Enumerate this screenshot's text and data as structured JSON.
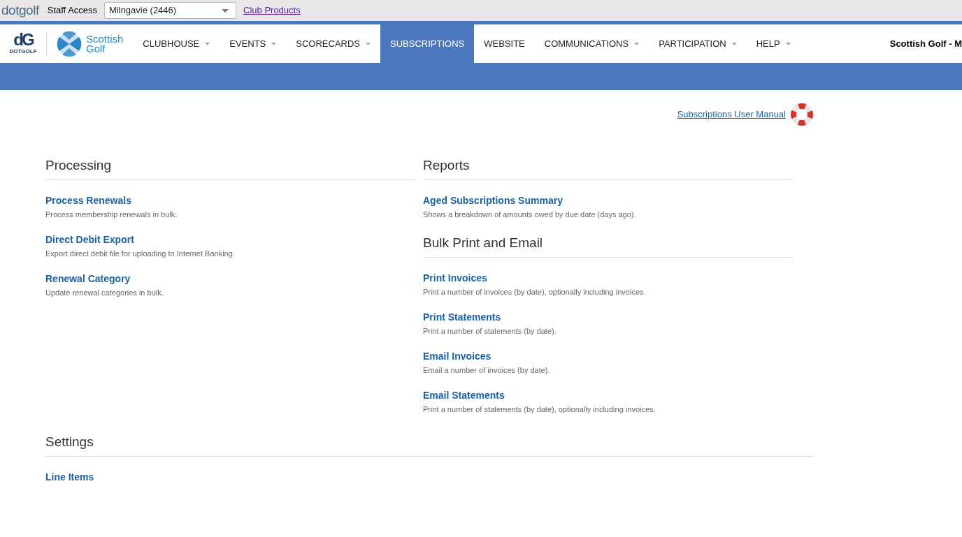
{
  "top_bar": {
    "logo": "dotgolf",
    "label": "Staff Access",
    "club_select": {
      "value": "Milngavie (2446)"
    },
    "link": "Club Products"
  },
  "nav": {
    "brand_mark": "dG",
    "brand_caption": "DOTGOLF",
    "partner_logo": [
      "Scottish",
      "Golf"
    ],
    "items": [
      {
        "label": "CLUBHOUSE",
        "dropdown": true,
        "selected": false
      },
      {
        "label": "EVENTS",
        "dropdown": true,
        "selected": false
      },
      {
        "label": "SCORECARDS",
        "dropdown": true,
        "selected": false
      },
      {
        "label": "SUBSCRIPTIONS",
        "dropdown": false,
        "selected": true
      },
      {
        "label": "WEBSITE",
        "dropdown": false,
        "selected": false
      },
      {
        "label": "COMMUNICATIONS",
        "dropdown": true,
        "selected": false
      },
      {
        "label": "PARTICIPATION",
        "dropdown": true,
        "selected": false
      },
      {
        "label": "HELP",
        "dropdown": true,
        "selected": false
      }
    ],
    "user": "Scottish Golf - M"
  },
  "manual_link": "Subscriptions User Manual",
  "sections": [
    {
      "title": "Processing",
      "links": [
        {
          "label": "Process Renewals",
          "description": "Process membership renewals in bulk."
        },
        {
          "label": "Direct Debit Export",
          "description": "Export direct debit file for uploading to Internet Banking."
        },
        {
          "label": "Renewal Category",
          "description": "Update renewal categories in bulk."
        }
      ]
    },
    {
      "title": "Reports",
      "links": [
        {
          "label": "Aged Subscriptions Summary",
          "description": "Shows a breakdown of amounts owed by due date (days ago)."
        }
      ]
    },
    {
      "title": "Bulk Print and Email",
      "links": [
        {
          "label": "Print Invoices",
          "description": "Print a number of invoices (by date), optionally including invoices."
        },
        {
          "label": "Print Statements",
          "description": "Print a number of statements (by date)."
        },
        {
          "label": "Email Invoices",
          "description": "Email a number of invoices (by date)."
        },
        {
          "label": "Email Statements",
          "description": "Print a number of statements (by date), optionally including invoices."
        }
      ]
    },
    {
      "title": "Settings",
      "links": [
        {
          "label": "Line Items"
        }
      ]
    }
  ]
}
